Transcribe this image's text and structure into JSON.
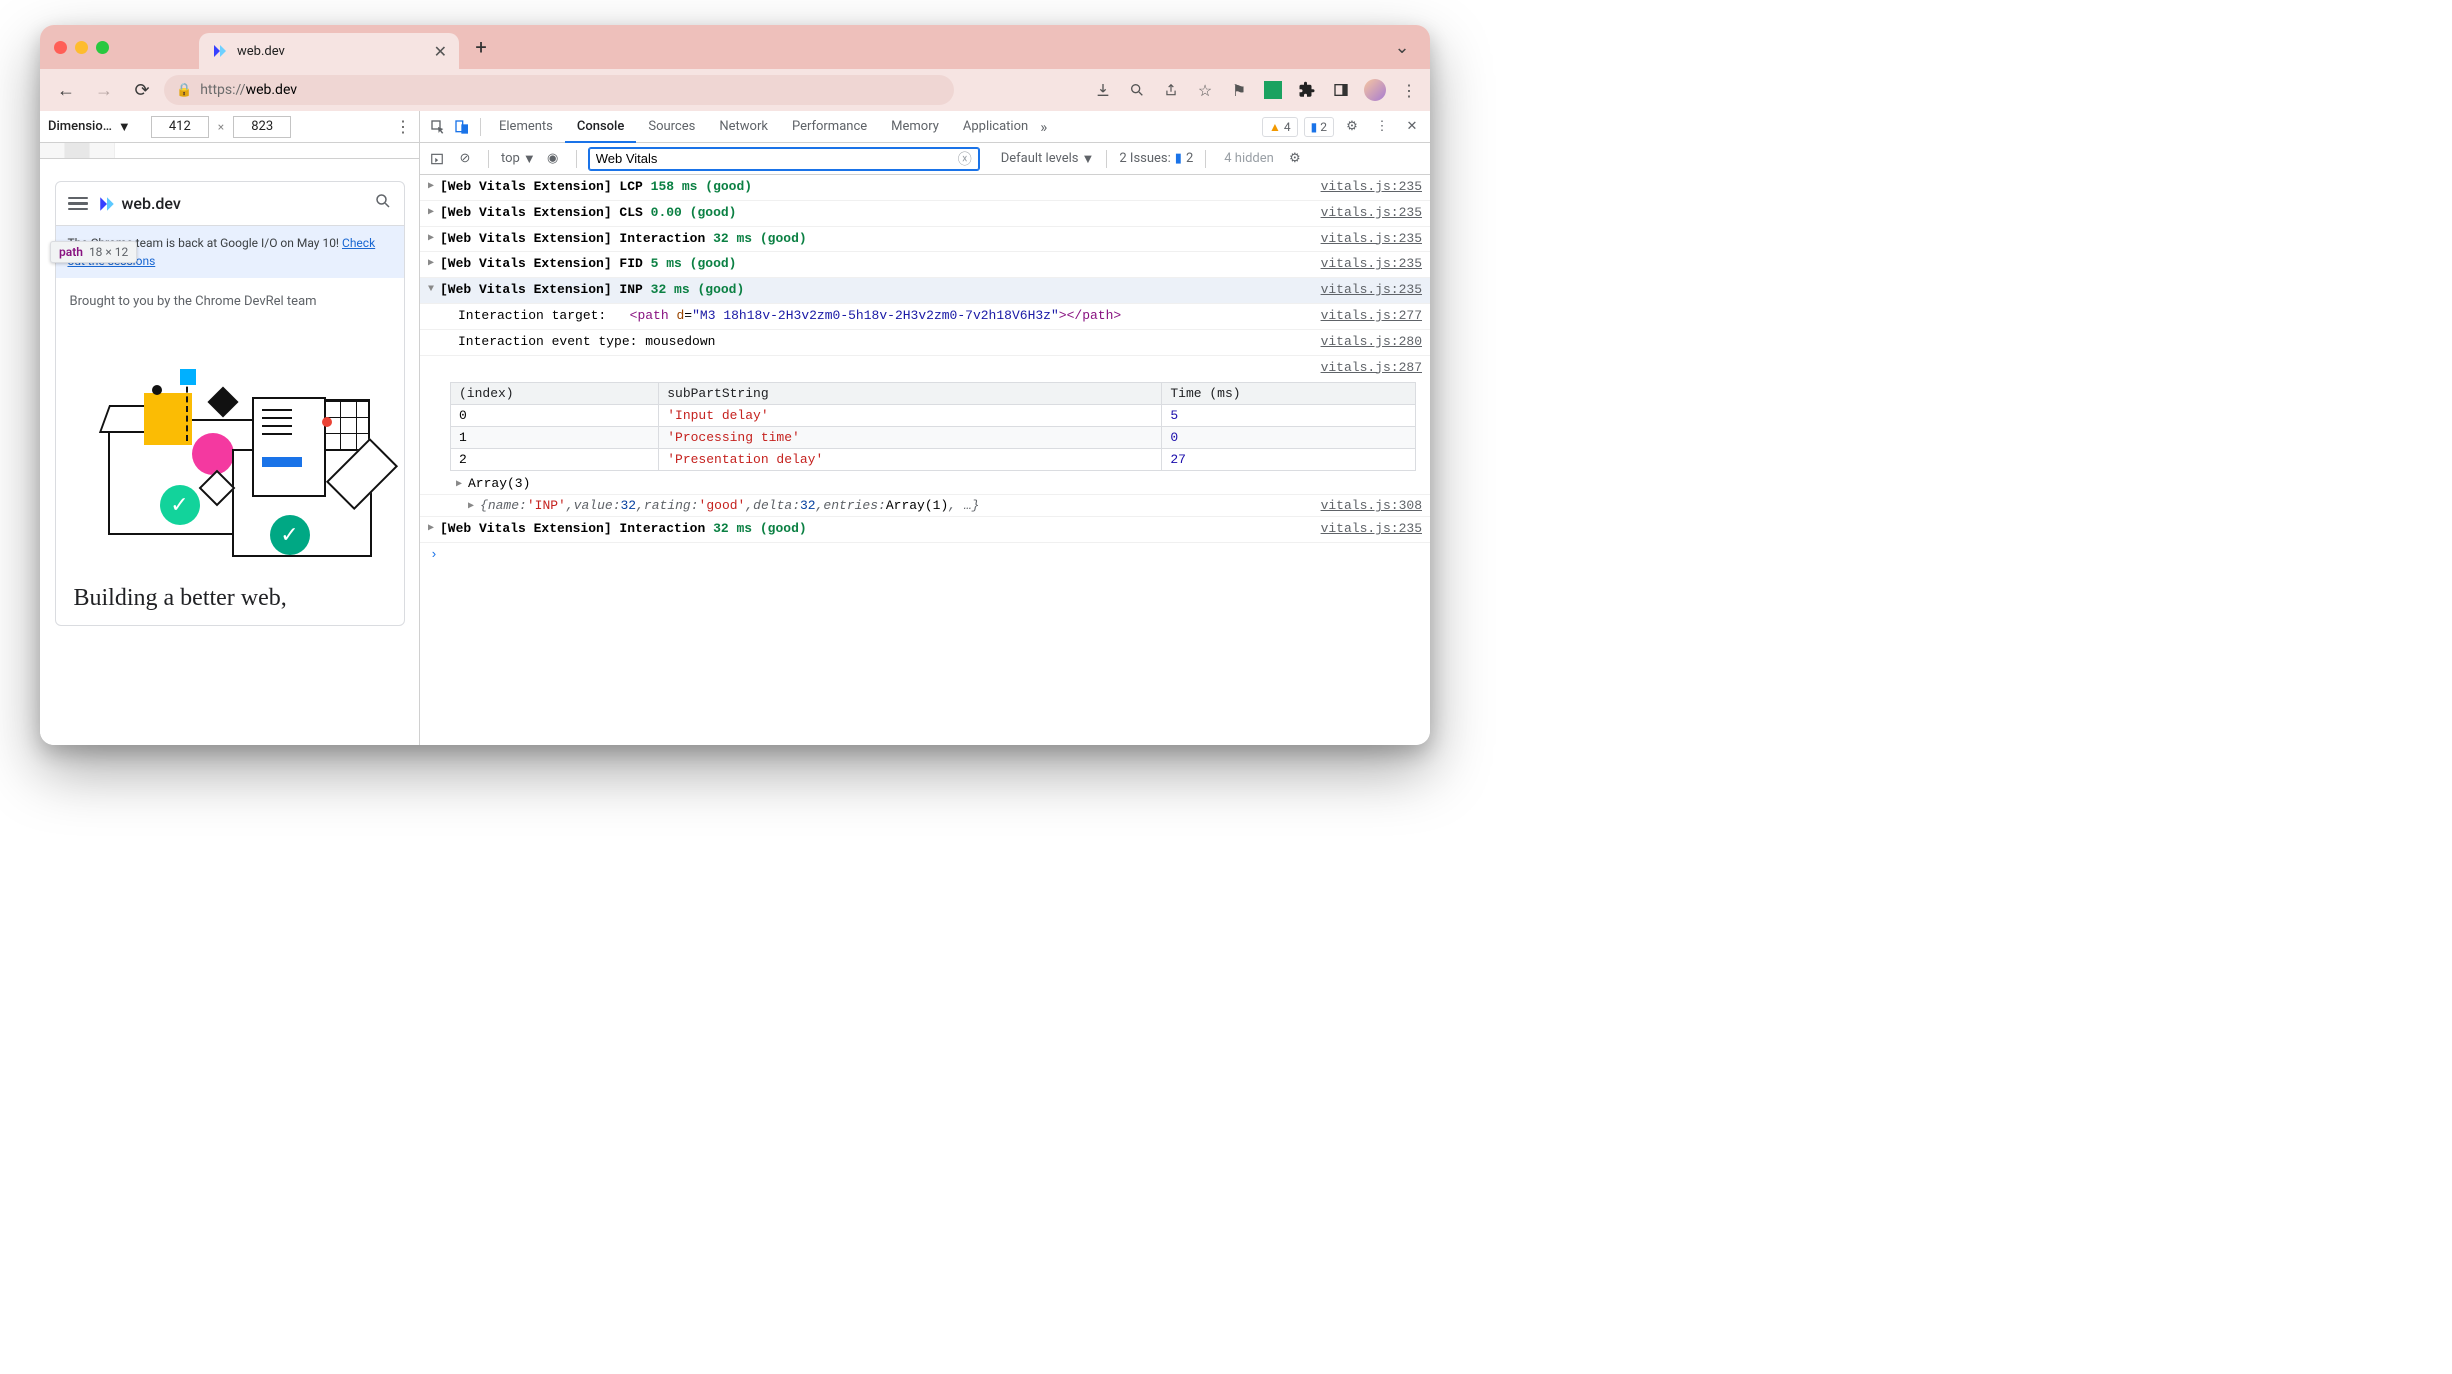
{
  "browser": {
    "tab_title": "web.dev",
    "url_scheme": "https://",
    "url_host": "web.dev",
    "nav_icons": [
      "download",
      "zoom",
      "share",
      "star",
      "flag",
      "puzzle",
      "sidepanel"
    ]
  },
  "device_toolbar": {
    "label": "Dimensio…",
    "width": "412",
    "height": "823"
  },
  "tooltip": {
    "tag": "path",
    "dims": "18 × 12"
  },
  "webdev": {
    "brand": "web.dev",
    "banner_pre": "The Chrome team is back at Google I/O on May 10! ",
    "banner_link": "Check out the sessions",
    "subhead": "Brought to you by the Chrome DevRel team",
    "hero": "Building a better web,"
  },
  "devtools": {
    "tabs": [
      "Elements",
      "Console",
      "Sources",
      "Network",
      "Performance",
      "Memory",
      "Application"
    ],
    "selected_tab": "Console",
    "warning_count": "4",
    "info_count": "2"
  },
  "console_tb": {
    "context": "top",
    "filter_value": "Web Vitals",
    "levels": "Default levels",
    "issues_label": "2 Issues:",
    "issues_count": "2",
    "hidden": "4 hidden"
  },
  "logs": [
    {
      "prefix": "[Web Vitals Extension] LCP",
      "val": "158 ms (good)",
      "src": "vitals.js:235"
    },
    {
      "prefix": "[Web Vitals Extension] CLS",
      "val": "0.00 (good)",
      "src": "vitals.js:235"
    },
    {
      "prefix": "[Web Vitals Extension] Interaction",
      "val": "32 ms (good)",
      "src": "vitals.js:235"
    },
    {
      "prefix": "[Web Vitals Extension] FID",
      "val": "5 ms (good)",
      "src": "vitals.js:235"
    },
    {
      "prefix": "[Web Vitals Extension] INP",
      "val": "32 ms (good)",
      "src": "vitals.js:235",
      "expanded": true
    }
  ],
  "details": {
    "target_label": "Interaction target:",
    "target_tag": "path",
    "target_attr": "d",
    "target_val": "\"M3 18h18v-2H3v2zm0-5h18v-2H3v2zm0-7v2h18V6H3z\"",
    "target_src": "vitals.js:277",
    "event_label": "Interaction event type: ",
    "event_val": "mousedown",
    "event_src": "vitals.js:280",
    "table_src": "vitals.js:287",
    "table_headers": [
      "(index)",
      "subPartString",
      "Time (ms)"
    ],
    "table_rows": [
      {
        "idx": "0",
        "sub": "'Input delay'",
        "time": "5"
      },
      {
        "idx": "1",
        "sub": "'Processing time'",
        "time": "0"
      },
      {
        "idx": "2",
        "sub": "'Presentation delay'",
        "time": "27"
      }
    ],
    "array_label": "Array(3)",
    "obj": {
      "parts": [
        {
          "k": "name",
          "v": "'INP'",
          "cls": "msg-red"
        },
        {
          "k": "value",
          "v": "32",
          "cls": "msg-blue"
        },
        {
          "k": "rating",
          "v": "'good'",
          "cls": "msg-red"
        },
        {
          "k": "delta",
          "v": "32",
          "cls": "msg-blue"
        },
        {
          "k": "entries",
          "v": "Array(1)",
          "cls": ""
        }
      ],
      "src": "vitals.js:308"
    }
  },
  "log_after": {
    "prefix": "[Web Vitals Extension] Interaction",
    "val": "32 ms (good)",
    "src": "vitals.js:235"
  }
}
